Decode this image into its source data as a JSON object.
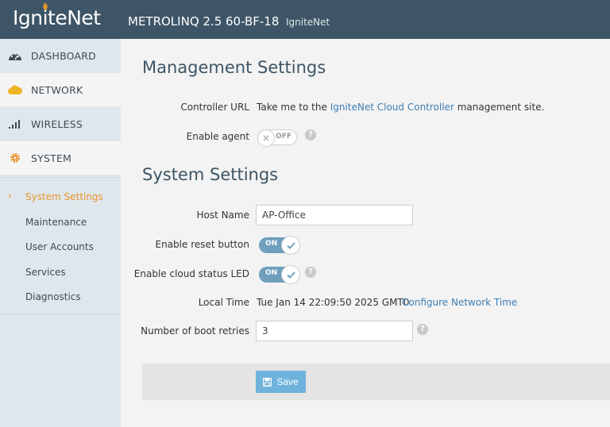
{
  "header": {
    "logo": "IgniteNet",
    "device_name": "METROLINQ 2.5 60-BF-18",
    "device_sub": "IgniteNet"
  },
  "sidebar": {
    "items": [
      {
        "label": "DASHBOARD",
        "icon": "dashboard-gauge-icon"
      },
      {
        "label": "NETWORK",
        "icon": "cloud-icon"
      },
      {
        "label": "WIRELESS",
        "icon": "signal-bars-icon"
      },
      {
        "label": "SYSTEM",
        "icon": "gear-icon"
      }
    ],
    "submenu": [
      {
        "label": "System Settings",
        "active": true
      },
      {
        "label": "Maintenance"
      },
      {
        "label": "User Accounts"
      },
      {
        "label": "Services"
      },
      {
        "label": "Diagnostics"
      }
    ]
  },
  "management": {
    "heading": "Management Settings",
    "controller_url_label": "Controller URL",
    "controller_text_pre": "Take me to the",
    "controller_link": "IgniteNet Cloud Controller",
    "controller_text_post": "management site.",
    "enable_agent_label": "Enable agent",
    "enable_agent_state": "OFF"
  },
  "system": {
    "heading": "System Settings",
    "host_name_label": "Host Name",
    "host_name_value": "AP-Office",
    "reset_button_label": "Enable reset button",
    "reset_button_state": "ON",
    "cloud_led_label": "Enable cloud status LED",
    "cloud_led_state": "ON",
    "local_time_label": "Local Time",
    "local_time_value": "Tue Jan 14 22:09:50 2025 GMT0",
    "configure_time_link": "Configure Network Time",
    "boot_retries_label": "Number of boot retries",
    "boot_retries_value": "3"
  },
  "actions": {
    "save_label": "Save"
  },
  "colors": {
    "header_bg": "#3d5566",
    "accent_orange": "#e6942b",
    "link_blue": "#3d7fb5",
    "toggle_on": "#6f9fbd",
    "save_button": "#6fb3dc"
  }
}
